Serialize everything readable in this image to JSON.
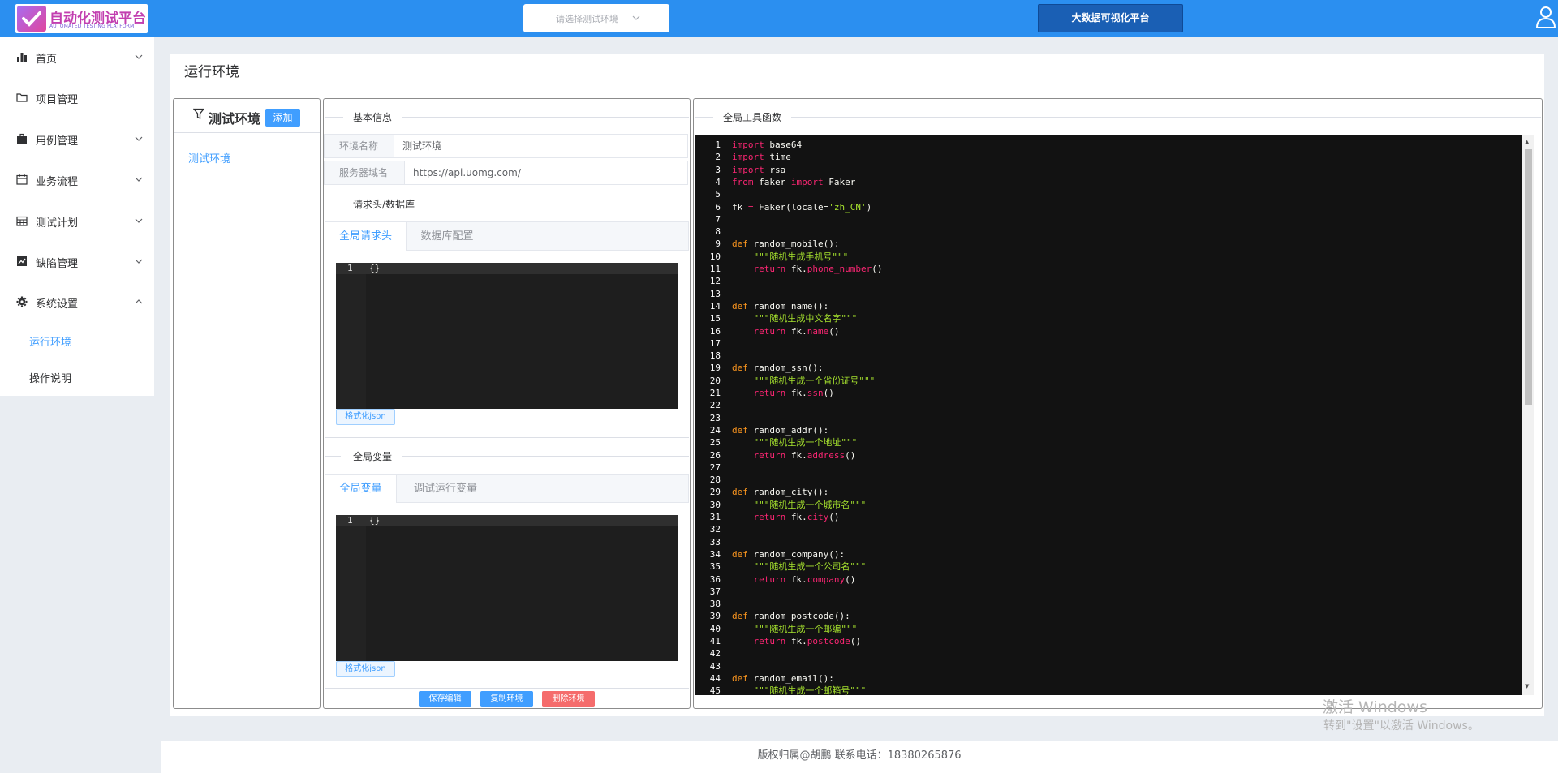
{
  "header": {
    "logo_title": "自动化测试平台",
    "logo_subtitle": "AUTOMATED TESTING PLATFORM",
    "env_select_placeholder": "请选择测试环境",
    "bigdata_label": "大数据可视化平台",
    "accent": "#2b8ff0"
  },
  "sidebar": {
    "items": [
      {
        "label": "首页",
        "icon": "bar-chart-icon",
        "arrow": "down"
      },
      {
        "label": "项目管理",
        "icon": "folder-icon",
        "arrow": "none"
      },
      {
        "label": "用例管理",
        "icon": "briefcase-icon",
        "arrow": "down"
      },
      {
        "label": "业务流程",
        "icon": "calendar-icon",
        "arrow": "down"
      },
      {
        "label": "测试计划",
        "icon": "calendar-grid-icon",
        "arrow": "down"
      },
      {
        "label": "缺陷管理",
        "icon": "trend-chart-icon",
        "arrow": "down"
      },
      {
        "label": "系统设置",
        "icon": "gear-icon",
        "arrow": "up"
      }
    ],
    "sub_items": [
      {
        "label": "运行环境",
        "active": true
      },
      {
        "label": "操作说明",
        "active": false
      }
    ]
  },
  "page": {
    "title": "运行环境"
  },
  "env_panel": {
    "title": "测试环境",
    "add_label": "添加",
    "items": [
      "测试环境"
    ]
  },
  "config_panel": {
    "basic_info": "基本信息",
    "env_name_label": "环境名称",
    "env_name_value": "测试环境",
    "host_label": "服务器域名",
    "host_value": "https://api.uomg.com/",
    "headers_db": "请求头/数据库",
    "tabs1": [
      "全局请求头",
      "数据库配置"
    ],
    "editor1": {
      "line": "1",
      "code": "{}"
    },
    "format_label": "格式化json",
    "global_vars": "全局变量",
    "tabs2": [
      "全局变量",
      "调试运行变量"
    ],
    "editor2": {
      "line": "1",
      "code": "{}"
    },
    "buttons": {
      "save": "保存编辑",
      "copy": "复制环境",
      "delete": "删除环境"
    }
  },
  "tools_panel": {
    "title": "全局工具函数",
    "lines": [
      {
        "n": "1",
        "parts": [
          [
            "kw",
            "import"
          ],
          [
            "p",
            " base64"
          ]
        ]
      },
      {
        "n": "2",
        "parts": [
          [
            "kw",
            "import"
          ],
          [
            "p",
            " time"
          ]
        ]
      },
      {
        "n": "3",
        "parts": [
          [
            "kw",
            "import"
          ],
          [
            "p",
            " rsa"
          ]
        ]
      },
      {
        "n": "4",
        "parts": [
          [
            "kw",
            "from"
          ],
          [
            "p",
            " faker "
          ],
          [
            "kw",
            "import"
          ],
          [
            "p",
            " Faker"
          ]
        ]
      },
      {
        "n": "5",
        "parts": []
      },
      {
        "n": "6",
        "parts": [
          [
            "p",
            "fk "
          ],
          [
            "kw",
            "="
          ],
          [
            "p",
            " Faker(locale="
          ],
          [
            "str",
            "'zh_CN'"
          ],
          [
            "p",
            ")"
          ]
        ]
      },
      {
        "n": "7",
        "parts": []
      },
      {
        "n": "8",
        "parts": []
      },
      {
        "n": "9",
        "parts": [
          [
            "kw2",
            "def"
          ],
          [
            "p",
            " random_mobile():"
          ]
        ]
      },
      {
        "n": "10",
        "parts": [
          [
            "str",
            "    \"\"\"随机生成手机号\"\"\""
          ]
        ]
      },
      {
        "n": "11",
        "parts": [
          [
            "kw",
            "    return"
          ],
          [
            "p",
            " fk."
          ],
          [
            "kw",
            "phone_number"
          ],
          [
            "p",
            "()"
          ]
        ]
      },
      {
        "n": "12",
        "parts": []
      },
      {
        "n": "13",
        "parts": []
      },
      {
        "n": "14",
        "parts": [
          [
            "kw2",
            "def"
          ],
          [
            "p",
            " random_name():"
          ]
        ]
      },
      {
        "n": "15",
        "parts": [
          [
            "str",
            "    \"\"\"随机生成中文名字\"\"\""
          ]
        ]
      },
      {
        "n": "16",
        "parts": [
          [
            "kw",
            "    return"
          ],
          [
            "p",
            " fk."
          ],
          [
            "kw",
            "name"
          ],
          [
            "p",
            "()"
          ]
        ]
      },
      {
        "n": "17",
        "parts": []
      },
      {
        "n": "18",
        "parts": []
      },
      {
        "n": "19",
        "parts": [
          [
            "kw2",
            "def"
          ],
          [
            "p",
            " random_ssn():"
          ]
        ]
      },
      {
        "n": "20",
        "parts": [
          [
            "str",
            "    \"\"\"随机生成一个省份证号\"\"\""
          ]
        ]
      },
      {
        "n": "21",
        "parts": [
          [
            "kw",
            "    return"
          ],
          [
            "p",
            " fk."
          ],
          [
            "kw",
            "ssn"
          ],
          [
            "p",
            "()"
          ]
        ]
      },
      {
        "n": "22",
        "parts": []
      },
      {
        "n": "23",
        "parts": []
      },
      {
        "n": "24",
        "parts": [
          [
            "kw2",
            "def"
          ],
          [
            "p",
            " random_addr():"
          ]
        ]
      },
      {
        "n": "25",
        "parts": [
          [
            "str",
            "    \"\"\"随机生成一个地址\"\"\""
          ]
        ]
      },
      {
        "n": "26",
        "parts": [
          [
            "kw",
            "    return"
          ],
          [
            "p",
            " fk."
          ],
          [
            "kw",
            "address"
          ],
          [
            "p",
            "()"
          ]
        ]
      },
      {
        "n": "27",
        "parts": []
      },
      {
        "n": "28",
        "parts": []
      },
      {
        "n": "29",
        "parts": [
          [
            "kw2",
            "def"
          ],
          [
            "p",
            " random_city():"
          ]
        ]
      },
      {
        "n": "30",
        "parts": [
          [
            "str",
            "    \"\"\"随机生成一个城市名\"\"\""
          ]
        ]
      },
      {
        "n": "31",
        "parts": [
          [
            "kw",
            "    return"
          ],
          [
            "p",
            " fk."
          ],
          [
            "kw",
            "city"
          ],
          [
            "p",
            "()"
          ]
        ]
      },
      {
        "n": "32",
        "parts": []
      },
      {
        "n": "33",
        "parts": []
      },
      {
        "n": "34",
        "parts": [
          [
            "kw2",
            "def"
          ],
          [
            "p",
            " random_company():"
          ]
        ]
      },
      {
        "n": "35",
        "parts": [
          [
            "str",
            "    \"\"\"随机生成一个公司名\"\"\""
          ]
        ]
      },
      {
        "n": "36",
        "parts": [
          [
            "kw",
            "    return"
          ],
          [
            "p",
            " fk."
          ],
          [
            "kw",
            "company"
          ],
          [
            "p",
            "()"
          ]
        ]
      },
      {
        "n": "37",
        "parts": []
      },
      {
        "n": "38",
        "parts": []
      },
      {
        "n": "39",
        "parts": [
          [
            "kw2",
            "def"
          ],
          [
            "p",
            " random_postcode():"
          ]
        ]
      },
      {
        "n": "40",
        "parts": [
          [
            "str",
            "    \"\"\"随机生成一个邮编\"\"\""
          ]
        ]
      },
      {
        "n": "41",
        "parts": [
          [
            "kw",
            "    return"
          ],
          [
            "p",
            " fk."
          ],
          [
            "kw",
            "postcode"
          ],
          [
            "p",
            "()"
          ]
        ]
      },
      {
        "n": "42",
        "parts": []
      },
      {
        "n": "43",
        "parts": []
      },
      {
        "n": "44",
        "parts": [
          [
            "kw2",
            "def"
          ],
          [
            "p",
            " random_email():"
          ]
        ]
      },
      {
        "n": "45",
        "parts": [
          [
            "str",
            "    \"\"\"随机生成一个邮箱号\"\"\""
          ]
        ]
      }
    ]
  },
  "watermark": {
    "line1": "激活 Windows",
    "line2": "转到\"设置\"以激活 Windows。"
  },
  "footer": {
    "text": "版权归属@胡鹏 联系电话：18380265876"
  }
}
